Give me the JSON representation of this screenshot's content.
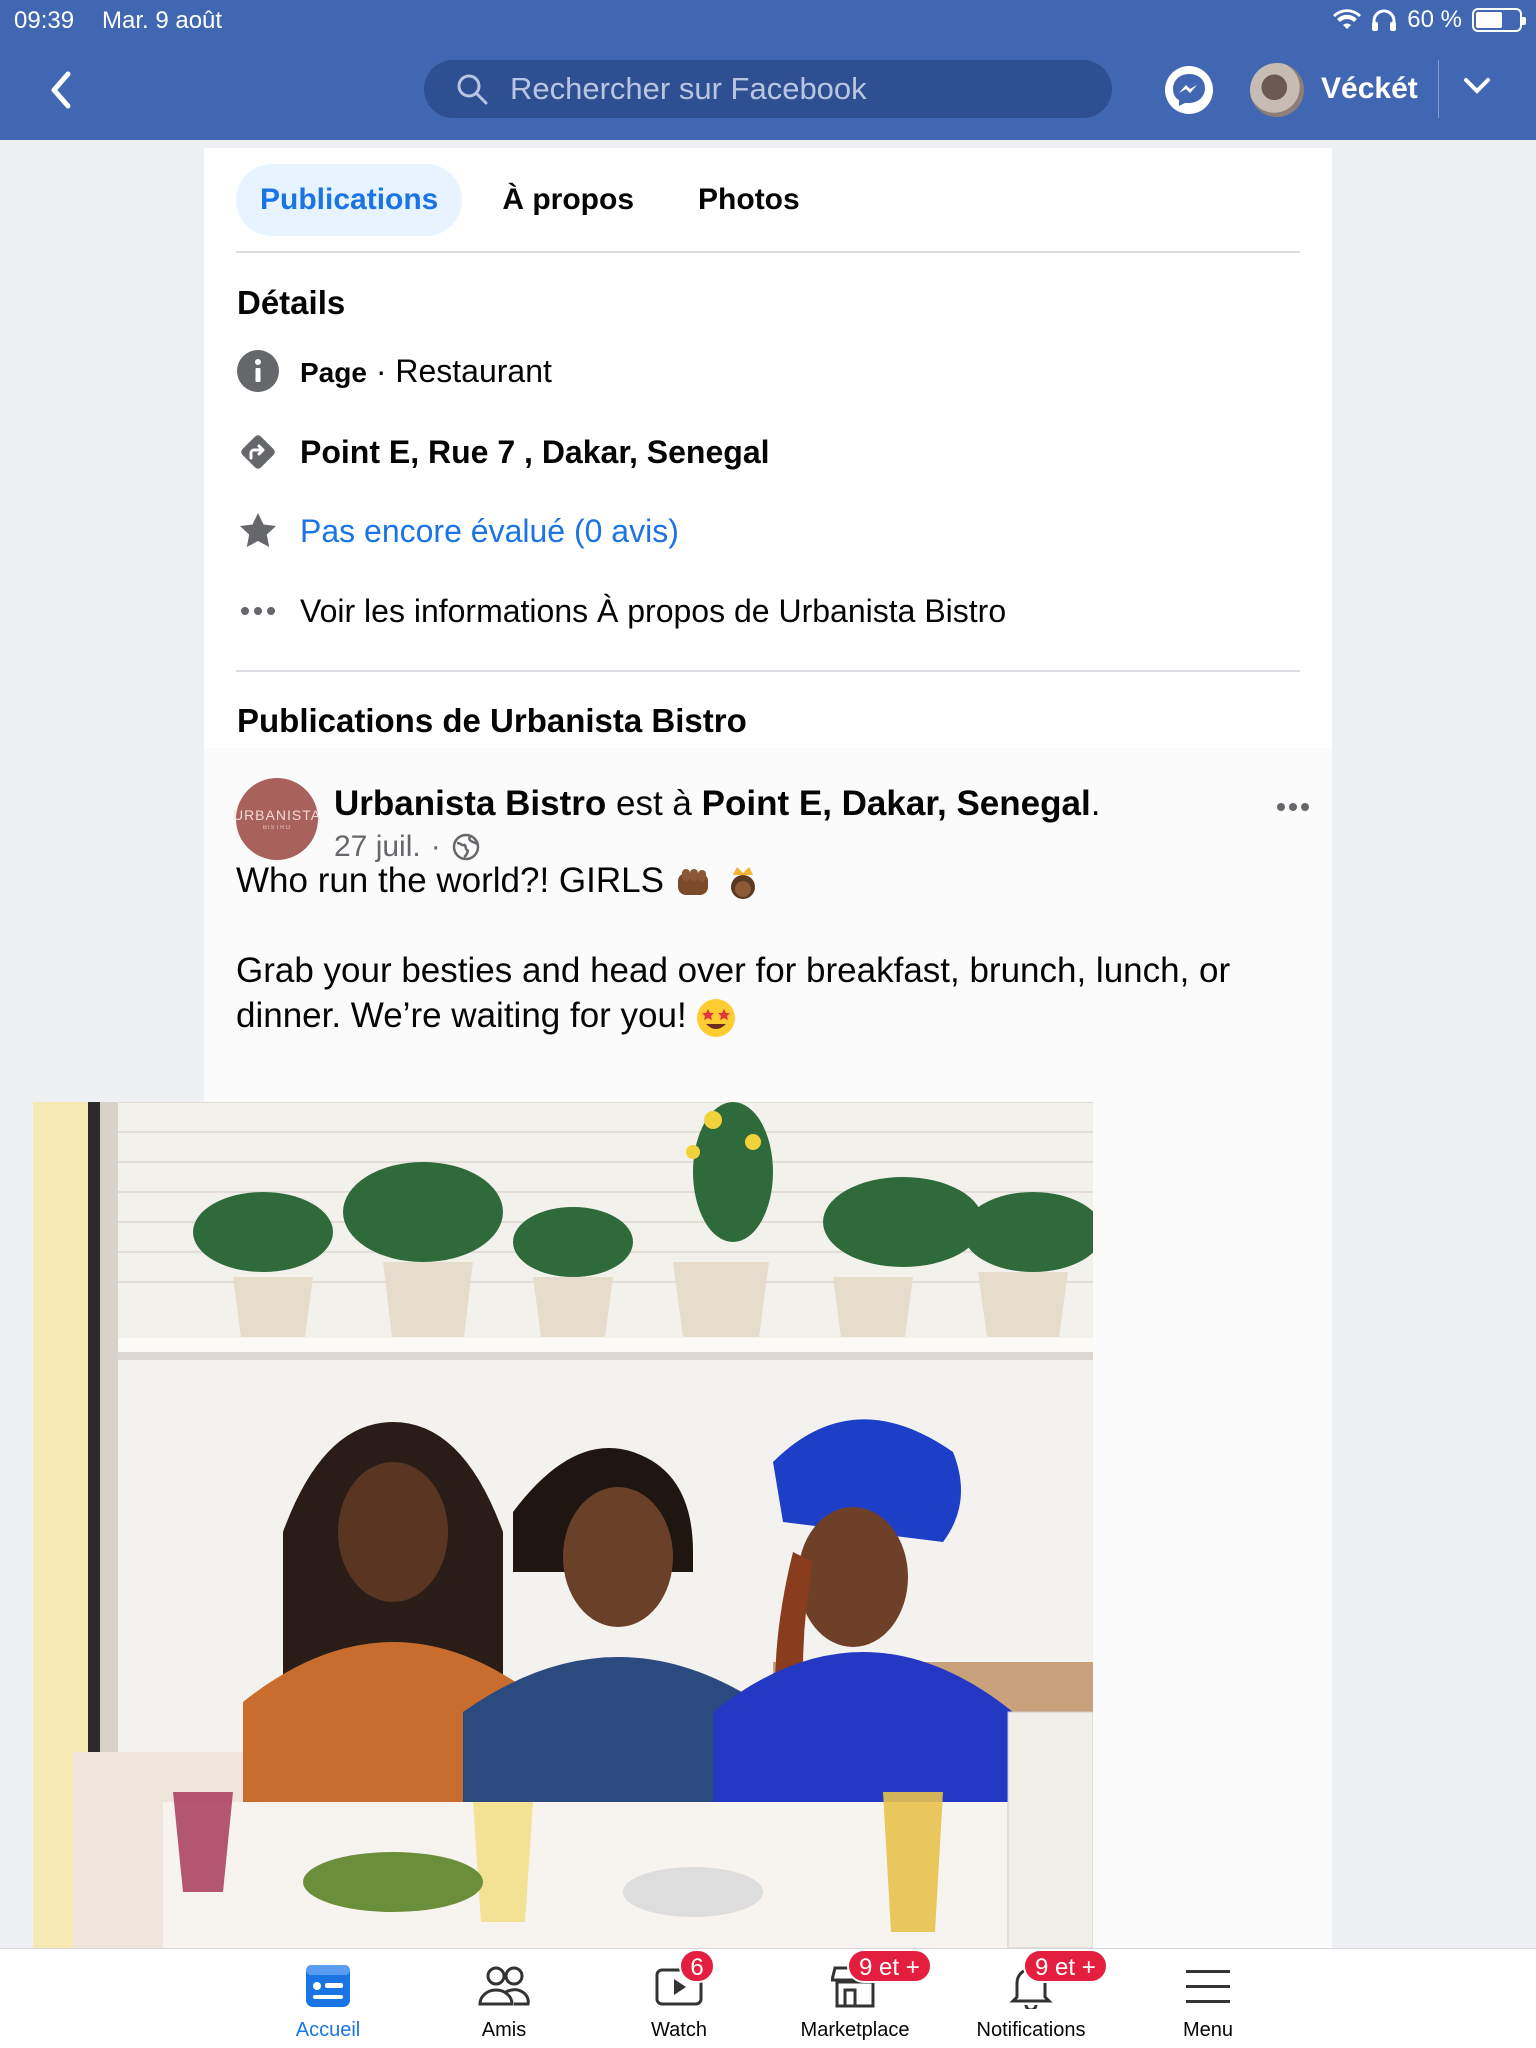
{
  "status_bar": {
    "time": "09:39",
    "date": "Mar. 9 août",
    "battery": "60 %"
  },
  "header": {
    "search_placeholder": "Rechercher sur Facebook",
    "username": "Véckét"
  },
  "tabs": [
    {
      "label": "Publications",
      "active": true
    },
    {
      "label": "À propos",
      "active": false
    },
    {
      "label": "Photos",
      "active": false
    }
  ],
  "details": {
    "title": "Détails",
    "category_label": "Page",
    "category_sep": "·",
    "category_value": "Restaurant",
    "address": "Point E, Rue 7 , Dakar, Senegal",
    "rating": "Pas encore évalué (0 avis)",
    "about_link": "Voir les informations À propos de Urbanista Bistro"
  },
  "posts_section": {
    "title": "Publications de Urbanista Bistro"
  },
  "post": {
    "logo_text": "URBANISTA",
    "logo_subtext": "BISTRO",
    "author": "Urbanista Bistro",
    "action": "est à",
    "location": "Point E, Dakar, Senegal",
    "location_end": ".",
    "date": "27 juil.",
    "date_sep": "·",
    "line1": "Who run the world?! GIRLS",
    "line2": "Grab your besties and head over for breakfast, brunch, lunch, or",
    "line3": "dinner. We’re waiting for you!"
  },
  "bottom_nav": [
    {
      "label": "Accueil",
      "icon": "home-feed-icon",
      "active": true
    },
    {
      "label": "Amis",
      "icon": "friends-icon",
      "active": false
    },
    {
      "label": "Watch",
      "icon": "watch-icon",
      "badge": "6",
      "active": false
    },
    {
      "label": "Marketplace",
      "icon": "marketplace-icon",
      "badge": "9 et +",
      "active": false
    },
    {
      "label": "Notifications",
      "icon": "bell-icon",
      "badge": "9 et +",
      "active": false
    },
    {
      "label": "Menu",
      "icon": "menu-icon",
      "active": false
    }
  ],
  "colors": {
    "header_bg": "#4267b2",
    "accent": "#1b74e4",
    "badge": "#e41e3f"
  }
}
